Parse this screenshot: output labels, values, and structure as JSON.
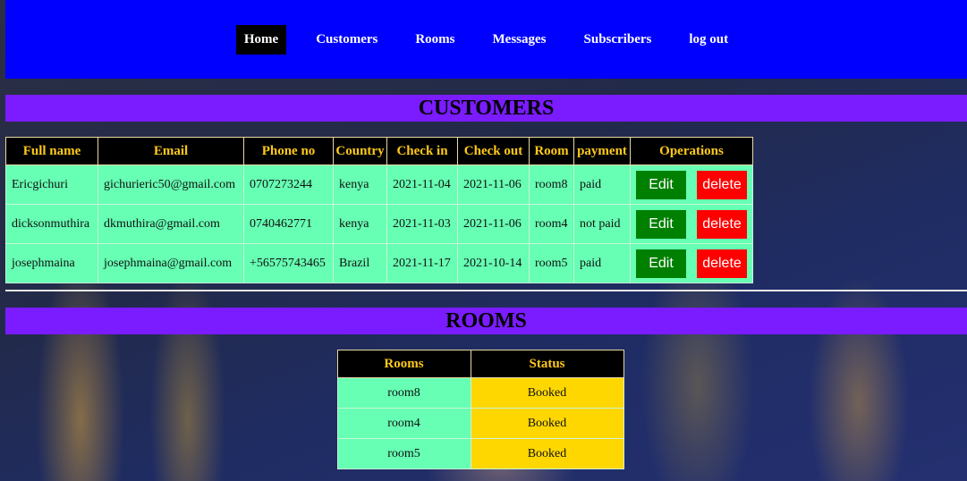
{
  "nav": {
    "items": [
      {
        "label": "Home",
        "active": true
      },
      {
        "label": "Customers",
        "active": false
      },
      {
        "label": "Rooms",
        "active": false
      },
      {
        "label": "Messages",
        "active": false
      },
      {
        "label": "Subscribers",
        "active": false
      },
      {
        "label": "log out",
        "active": false
      }
    ]
  },
  "customers": {
    "title": "CUSTOMERS",
    "columns": [
      "Full name",
      "Email",
      "Phone no",
      "Country",
      "Check in",
      "Check out",
      "Room",
      "payment",
      "Operations"
    ],
    "rows": [
      [
        "Ericgichuri",
        "gichurieric50@gmail.com",
        "0707273244",
        "kenya",
        "2021-11-04",
        "2021-11-06",
        "room8",
        "paid"
      ],
      [
        "dicksonmuthira",
        "dkmuthira@gmail.com",
        "0740462771",
        "kenya",
        "2021-11-03",
        "2021-11-06",
        "room4",
        "not paid"
      ],
      [
        "josephmaina",
        "josephmaina@gmail.com",
        "+56575743465",
        "Brazil",
        "2021-11-17",
        "2021-10-14",
        "room5",
        "paid"
      ]
    ],
    "edit_label": "Edit",
    "delete_label": "delete"
  },
  "rooms": {
    "title": "ROOMS",
    "columns": [
      "Rooms",
      "Status"
    ],
    "rows": [
      [
        "room8",
        "Booked"
      ],
      [
        "room4",
        "Booked"
      ],
      [
        "room5",
        "Booked"
      ]
    ]
  },
  "colors": {
    "navbar": "#0000ff",
    "section_header": "#7a1cff",
    "table_header_text": "#ffc91a",
    "cell_green": "#66ffb3",
    "status_yellow": "#ffd700",
    "edit_button": "#008000",
    "delete_button": "#ff0000"
  }
}
